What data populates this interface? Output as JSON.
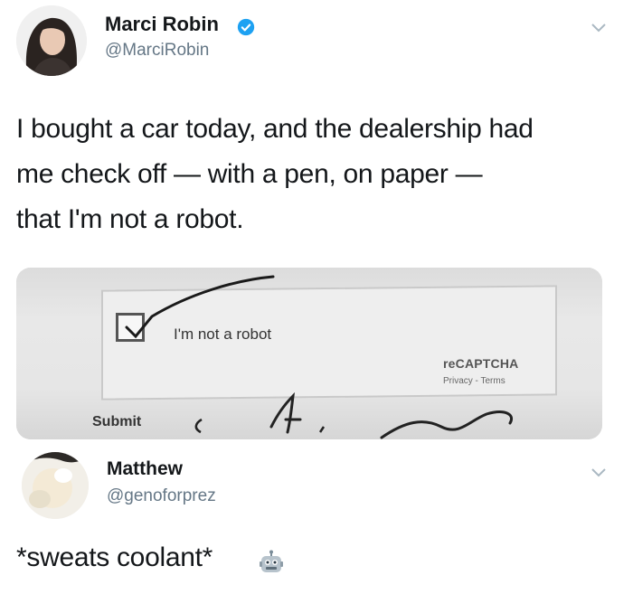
{
  "tweet": {
    "author_name": "Marci Robin",
    "author_handle": "@MarciRobin",
    "verified": true,
    "text_line1": "I bought a car today, and the dealership had",
    "text_line2": "me check off — with a pen, on paper —",
    "text_line3": "that I'm not a robot."
  },
  "photo": {
    "checkbox_label": "I'm not a robot",
    "recaptcha_brand": "reCAPTCHA",
    "recaptcha_links": "Privacy - Terms",
    "submit_label": "Submit"
  },
  "reply": {
    "author_name": "Matthew",
    "author_handle": "@genoforprez",
    "text": "*sweats coolant*",
    "emoji_icon": "robot-face-icon"
  },
  "colors": {
    "verified_blue": "#1da1f2",
    "handle_gray": "#657786",
    "text_dark": "#14171a"
  }
}
